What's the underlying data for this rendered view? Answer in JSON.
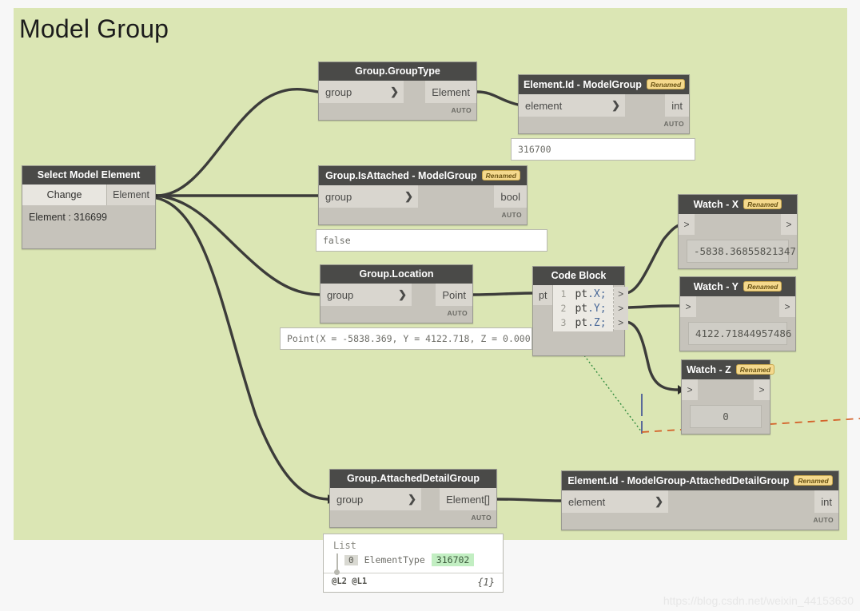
{
  "group": {
    "title": "Model Group",
    "background_color": "#dbe6b4"
  },
  "watermark": "https://blog.csdn.net/weixin_44153630",
  "badges": {
    "renamed": "Renamed",
    "auto": "AUTO"
  },
  "nodes": {
    "select_model_element": {
      "title": "Select Model Element",
      "button": "Change",
      "output": "Element",
      "value_text": "Element : 316699"
    },
    "group_grouptype": {
      "title": "Group.GroupType",
      "input": "group",
      "output": "Element",
      "auto": "AUTO"
    },
    "element_id_modelgroup": {
      "title": "Element.Id - ModelGroup",
      "badge": "Renamed",
      "input": "element",
      "output": "int",
      "auto": "AUTO",
      "preview": "316700"
    },
    "group_isattached": {
      "title": "Group.IsAttached - ModelGroup",
      "badge": "Renamed",
      "input": "group",
      "output": "bool",
      "auto": "AUTO",
      "preview": "false"
    },
    "group_location": {
      "title": "Group.Location",
      "input": "group",
      "output": "Point",
      "auto": "AUTO",
      "preview": "Point(X = -5838.369, Y = 4122.718, Z = 0.000"
    },
    "code_block": {
      "title": "Code Block",
      "input": "pt",
      "lines": [
        {
          "num": "1",
          "obj": "pt",
          "prop": ".X;"
        },
        {
          "num": "2",
          "obj": "pt",
          "prop": ".Y;"
        },
        {
          "num": "3",
          "obj": "pt",
          "prop": ".Z;"
        }
      ],
      "out_glyph": ">"
    },
    "watch_x": {
      "title": "Watch - X",
      "badge": "Renamed",
      "in_glyph": ">",
      "out_glyph": ">",
      "value": "-5838.36855821347"
    },
    "watch_y": {
      "title": "Watch - Y",
      "badge": "Renamed",
      "in_glyph": ">",
      "out_glyph": ">",
      "value": "4122.71844957486"
    },
    "watch_z": {
      "title": "Watch - Z",
      "badge": "Renamed",
      "in_glyph": ">",
      "out_glyph": ">",
      "value": "0"
    },
    "group_attacheddetailgroup": {
      "title": "Group.AttachedDetailGroup",
      "input": "group",
      "output": "Element[]",
      "auto": "AUTO"
    },
    "element_id_attached": {
      "title": "Element.Id - ModelGroup-AttachedDetailGroup",
      "badge": "Renamed",
      "input": "element",
      "output": "int",
      "auto": "AUTO"
    }
  },
  "list_preview": {
    "title": "List",
    "index": "0",
    "type": "ElementType",
    "value": "316702",
    "levels": "@L2 @L1",
    "count": "{1}"
  },
  "colors": {
    "node_header": "#4a4a48",
    "node_body": "#c6c3bb",
    "port": "#d9d6cf",
    "wire": "#3c3c3a",
    "badge_bg": "#f5d98d",
    "list_value_bg": "#c2eec2",
    "dashed_orange": "#d4622a",
    "dotted_green": "#2f8a3e",
    "blue_line": "#5a6a9a"
  }
}
